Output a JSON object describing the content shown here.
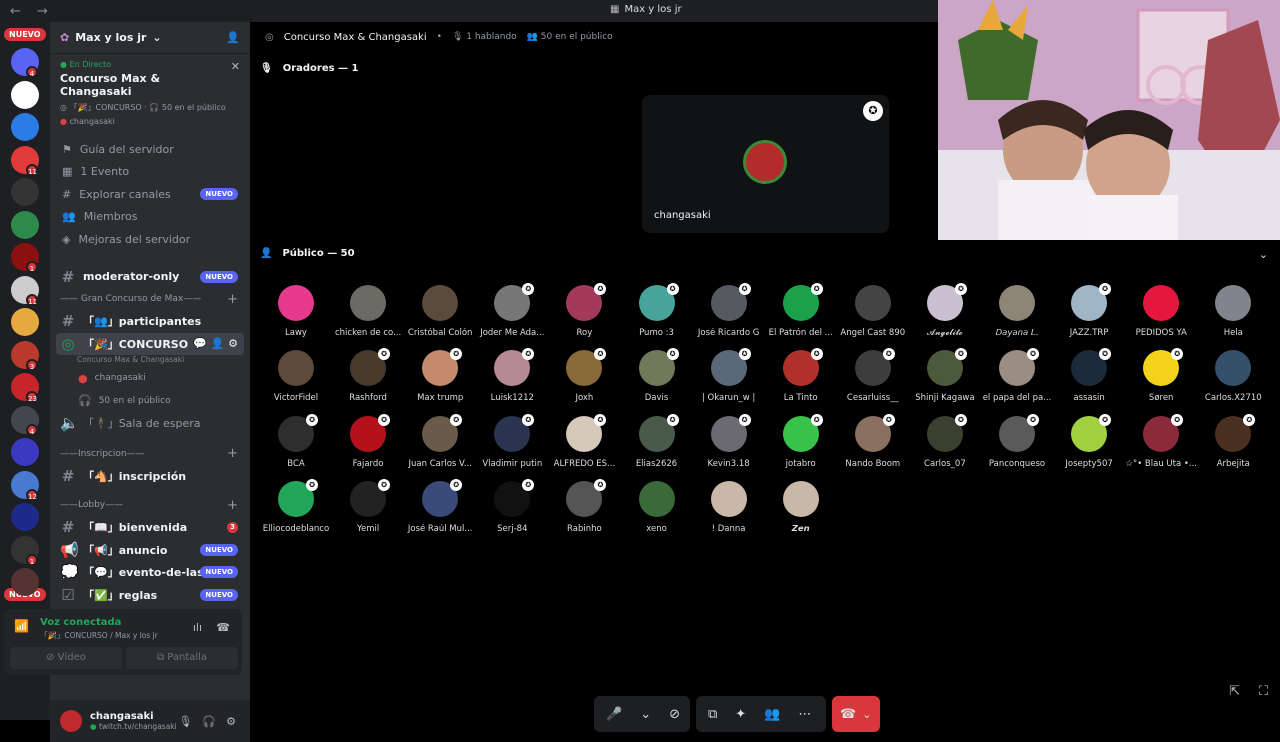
{
  "window": {
    "nav": "← →",
    "title": "Max y los jr"
  },
  "guilds": {
    "nuevo_top": "NUEVO",
    "nuevo_bottom": "NUEVO",
    "items": [
      {
        "color": "#5865f2",
        "badge": "4"
      },
      {
        "color": "#ffffff",
        "badge": ""
      },
      {
        "color": "#2a7be4",
        "badge": ""
      },
      {
        "color": "#e03a3a",
        "badge": "11"
      },
      {
        "color": "#333333",
        "badge": ""
      },
      {
        "color": "#2d8a4a",
        "badge": ""
      },
      {
        "color": "#8b1010",
        "badge": "1"
      },
      {
        "color": "#cccccc",
        "badge": "11"
      },
      {
        "color": "#e6a940",
        "badge": ""
      },
      {
        "color": "#b9392c",
        "badge": "3"
      },
      {
        "color": "#c6252a",
        "badge": "23"
      },
      {
        "color": "#44464c",
        "badge": "4"
      },
      {
        "color": "#3a3ac0",
        "badge": ""
      },
      {
        "color": "#4a7ad0",
        "badge": "12"
      },
      {
        "color": "#1e2a8a",
        "badge": ""
      },
      {
        "color": "#333333",
        "badge": "1"
      },
      {
        "color": "#553333",
        "badge": ""
      }
    ]
  },
  "sidebar": {
    "server_name": "Max y los jr",
    "live": {
      "tag": "En Directo",
      "name": "Concurso Max & Changasaki",
      "channel": "「🎉」CONCURSO",
      "audience": "50 en el público",
      "host": "changasaki"
    },
    "server_items": [
      "Guía del servidor",
      "1 Evento",
      "Explorar canales",
      "Miembros",
      "Mejoras del servidor"
    ],
    "server_items_badge": "NUEVO",
    "channels": {
      "moderator": "moderator-only",
      "moderator_badge": "NUEVO",
      "cat1": "—— Gran Concurso de Max——",
      "participantes": "「👥」participantes",
      "concurso": "「🎉」CONCURSO",
      "concurso_sub": "Concurso Max & Changasaki",
      "host": "changasaki",
      "audience": "50 en el público",
      "espera": "「🕴」Sala de espera",
      "cat2": "——Inscripcion——",
      "inscripcion": "「🐴」inscripción",
      "cat3": "——Lobby——",
      "bienvenida": "「📖」bienvenida",
      "bienvenida_badge": "3",
      "anuncio": "「📢」anuncio",
      "anuncio_badge": "NUEVO",
      "evento": "「💬」evento-de-las...",
      "evento_badge": "NUEVO",
      "reglas": "「✅」reglas",
      "reglas_badge": "NUEVO"
    },
    "voice": {
      "status": "Voz conectada",
      "channel": "「🎉」CONCURSO / Max y los jr",
      "video": "Vídeo",
      "screen": "Pantalla"
    },
    "user": {
      "name": "changasaki",
      "status": "twitch.tv/changasaki"
    }
  },
  "stage": {
    "title": "Concurso Max & Changasaki",
    "speaking": "1 hablando",
    "audience": "50 en el público",
    "speakers_label": "Oradores — 1",
    "speaker_name": "changasaki",
    "audience_label": "Público — 50",
    "audience_list": [
      {
        "name": "Lawy",
        "color": "#e73a8f",
        "mic": false
      },
      {
        "name": "chicken de co...",
        "color": "#6b6a63",
        "mic": false
      },
      {
        "name": "Cristóbal Colón",
        "color": "#5a4b3c",
        "mic": false
      },
      {
        "name": "Joder Me Ada...",
        "color": "#777777",
        "mic": true
      },
      {
        "name": "Roy",
        "color": "#a33a5c",
        "mic": true
      },
      {
        "name": "Pumo :3",
        "color": "#48a39b",
        "mic": true
      },
      {
        "name": "José Ricardo G",
        "color": "#555a60",
        "mic": true
      },
      {
        "name": "El Patrón del ...",
        "color": "#1aa14a",
        "mic": true
      },
      {
        "name": "Angel Cast 890",
        "color": "#444444",
        "mic": false
      },
      {
        "name": "𝓐𝓷𝓰𝓮𝓵𝓲𝓽𝓸",
        "color": "#c9c1d2",
        "mic": true
      },
      {
        "name": "𝘋𝘢𝘺𝘢𝘯𝘢 𝘓.",
        "color": "#8d8578",
        "mic": false
      },
      {
        "name": "JAZZ.TRP",
        "color": "#9fb4c4",
        "mic": true
      },
      {
        "name": "PEDIDOS YA",
        "color": "#e5173f",
        "mic": false
      },
      {
        "name": "Hela",
        "color": "#80848e",
        "mic": false
      },
      {
        "name": "VictorFidel",
        "color": "#5c4a3b",
        "mic": false
      },
      {
        "name": "Rashford",
        "color": "#4a3a2a",
        "mic": true
      },
      {
        "name": "Max trump",
        "color": "#c48a6e",
        "mic": true
      },
      {
        "name": "Luisk1212",
        "color": "#b58a90",
        "mic": true
      },
      {
        "name": "Joxh",
        "color": "#8a6a3a",
        "mic": true
      },
      {
        "name": "Davis",
        "color": "#6e7a5a",
        "mic": true
      },
      {
        "name": "| Okarun_w |",
        "color": "#5b6878",
        "mic": true
      },
      {
        "name": "La Tinto",
        "color": "#b0312a",
        "mic": true
      },
      {
        "name": "Cesarluiss__",
        "color": "#3d3d3d",
        "mic": true
      },
      {
        "name": "Shinji Kagawa",
        "color": "#4a5a3a",
        "mic": true
      },
      {
        "name": "el papa del pa...",
        "color": "#9a8e84",
        "mic": true
      },
      {
        "name": "assasin",
        "color": "#1c2a3a",
        "mic": true
      },
      {
        "name": "Søren",
        "color": "#f2d21b",
        "mic": true
      },
      {
        "name": "Carlos.X2710",
        "color": "#355068",
        "mic": false
      },
      {
        "name": "BCA",
        "color": "#2e2e2e",
        "mic": true
      },
      {
        "name": "Fajardo",
        "color": "#b3121c",
        "mic": true
      },
      {
        "name": "Juan Carlos V...",
        "color": "#6a5a4a",
        "mic": true
      },
      {
        "name": "Vladimir putin",
        "color": "#2a3450",
        "mic": true
      },
      {
        "name": "ALFREDO ES...",
        "color": "#d4c8b8",
        "mic": true
      },
      {
        "name": "Elias2626",
        "color": "#4a5a4a",
        "mic": true
      },
      {
        "name": "Kevin3.18",
        "color": "#6a6a70",
        "mic": true
      },
      {
        "name": "jotabro",
        "color": "#38c24a",
        "mic": true
      },
      {
        "name": "Nando Boom",
        "color": "#8a7060",
        "mic": true
      },
      {
        "name": "Carlos_07",
        "color": "#3a4030",
        "mic": true
      },
      {
        "name": "Panconqueso",
        "color": "#5a5a5a",
        "mic": true
      },
      {
        "name": "Josepty507",
        "color": "#a0d040",
        "mic": true
      },
      {
        "name": "☆°• Blau Uta •...",
        "color": "#8a2a3a",
        "mic": true
      },
      {
        "name": "Arbejita",
        "color": "#4a3020",
        "mic": true
      },
      {
        "name": "Elliocodeblanco",
        "color": "#23a55a",
        "mic": true
      },
      {
        "name": "Yemil",
        "color": "#222222",
        "mic": true
      },
      {
        "name": "José Raúl Mul...",
        "color": "#3a4a7a",
        "mic": true
      },
      {
        "name": "Serj-84",
        "color": "#111111",
        "mic": true
      },
      {
        "name": "Rabinho",
        "color": "#555555",
        "mic": true
      },
      {
        "name": "xeno",
        "color": "#3a6a3a",
        "mic": false
      },
      {
        "name": "! Danna",
        "color": "#c9b8a8",
        "mic": false
      },
      {
        "name": "𝙕𝙚𝙣",
        "color": "#c8b8a8",
        "mic": false
      }
    ]
  },
  "controls": {
    "mic": "🎤",
    "chev": "⌄",
    "video_off": "⊘",
    "share": "⧉",
    "activity": "✦",
    "more": "⋯",
    "leave": "☎"
  }
}
